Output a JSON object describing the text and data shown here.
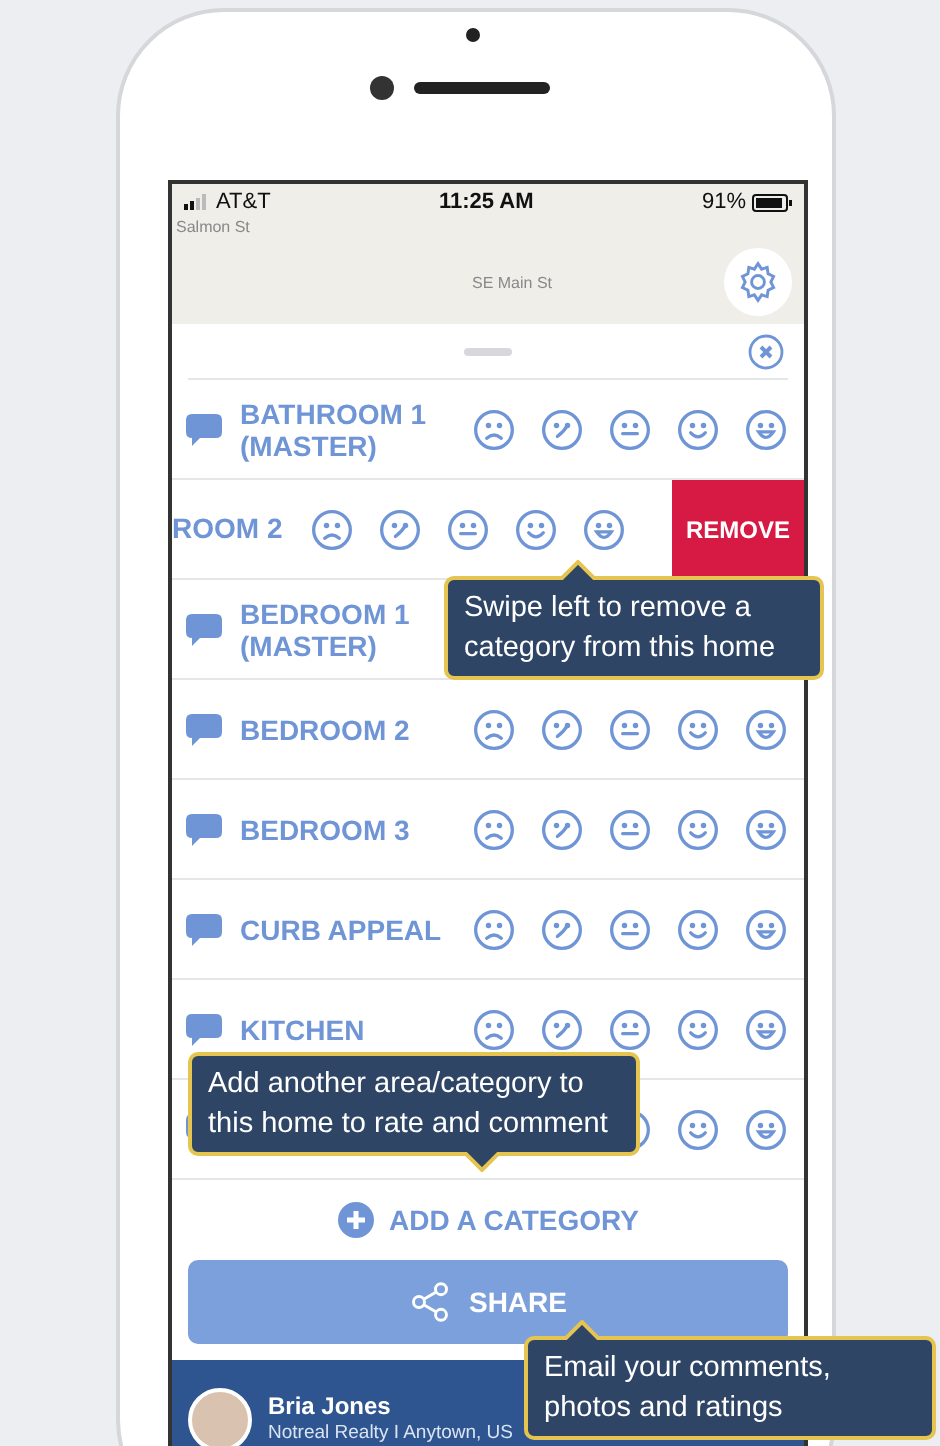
{
  "status_bar": {
    "carrier": "AT&T",
    "time": "11:25 AM",
    "battery": "91%"
  },
  "map": {
    "streets": [
      "Salmon St",
      "SE Main St"
    ]
  },
  "categories": [
    {
      "kind": "normal",
      "name": "BATHROOM 1 (MASTER)"
    },
    {
      "kind": "swiped",
      "name": "ROOM 2",
      "action": "REMOVE"
    },
    {
      "kind": "normal",
      "name": "BEDROOM 1 (MASTER)"
    },
    {
      "kind": "normal",
      "name": "BEDROOM 2"
    },
    {
      "kind": "normal",
      "name": "BEDROOM 3"
    },
    {
      "kind": "normal",
      "name": "CURB APPEAL"
    },
    {
      "kind": "normal",
      "name": "KITCHEN"
    },
    {
      "kind": "covered"
    }
  ],
  "add_category": "ADD A CATEGORY",
  "share_button": "SHARE",
  "agent": {
    "name": "Bria Jones",
    "company": "Notreal Realty I Anytown, US"
  },
  "tips": [
    "Swipe left to remove a category from this home",
    "Add another area/category to this home to rate and comment",
    "Email your comments, photos and ratings"
  ]
}
